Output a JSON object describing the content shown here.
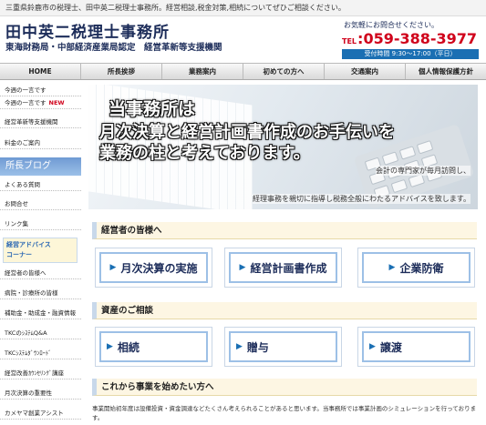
{
  "top_bar": "三重県鈴鹿市の税理士、田中英二税理士事務所。経営相談,税金対策,相続についてぜひご相談ください。",
  "header": {
    "title": "田中英二税理士事務所",
    "subtitle": "東海財務局・中部経済産業局認定　経営革新等支援機関",
    "contact_lead": "お気軽にお問合せください。",
    "tel_label": "TEL",
    "tel_number": "059-388-3977",
    "hours": "受付時間 9:30～17:00（平日）"
  },
  "nav": [
    "HOME",
    "所長挨拶",
    "業務案内",
    "初めての方へ",
    "交通案内",
    "個人情報保護方針"
  ],
  "sidebar": {
    "items": [
      {
        "label": "今週の一言です"
      },
      {
        "label": "今週の一言です",
        "badge": "NEW"
      },
      {
        "label": "経営革新等支援機関"
      },
      {
        "label": "料金のご案内"
      },
      {
        "label": "よくある質問"
      },
      {
        "label": "お問合せ"
      },
      {
        "label": "リンク集"
      }
    ],
    "blog": "所長ブログ",
    "advice_banner": [
      "経営アドバイス",
      "コーナー"
    ],
    "items_lower": [
      "経営者の皆様へ",
      "病院・診療所の皆様",
      "補助金・助成金・融資情報",
      "TKCのｼｽﾃﾑQ&A",
      "TKCｼｽﾃﾑﾀﾞｳﾝﾛｰﾄﾞ",
      "経営改善ｶｳﾝｾﾘﾝｸﾞ講座",
      "月次決算の重要性",
      "カメヤマ創業アシスト"
    ]
  },
  "hero": {
    "line1": "当事務所は",
    "line2": "月次決算と経営計画書作成のお手伝いを",
    "line3": "業務の柱と考えております。",
    "sub1": "会計の専門家が毎月訪問し、",
    "sub2": "経理事務を親切に指導し税務全般にわたるアドバイスを致します。"
  },
  "sections": [
    {
      "title": "経営者の皆様へ",
      "cards": [
        "月次決算の実施",
        "経営計画書作成",
        "企業防衛"
      ]
    },
    {
      "title": "資産のご相談",
      "cards": [
        "相続",
        "贈与",
        "譲渡"
      ]
    },
    {
      "title": "これから事業を始めたい方へ"
    }
  ],
  "footer_text": "事業開始初年度は設備投資・資金調達などたくさん考えられることがあると思います。当事務所では事業計画のシミュレーションを行っております。"
}
